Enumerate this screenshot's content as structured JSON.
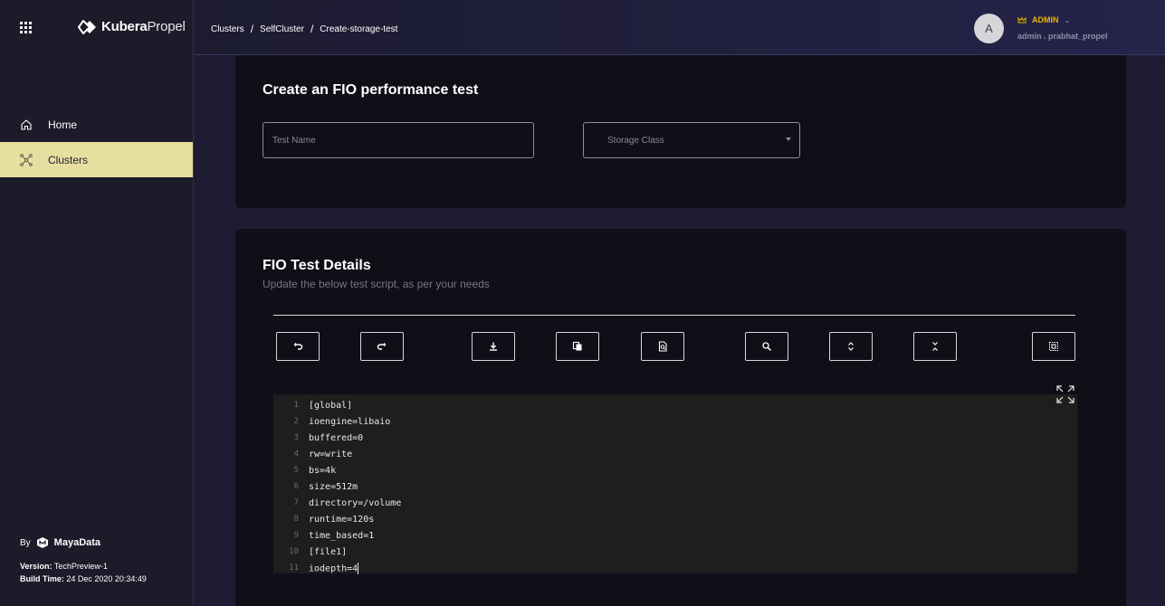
{
  "sidebar": {
    "logo": {
      "bold": "Kubera",
      "light": "Propel"
    },
    "nav": [
      {
        "label": "Home",
        "icon": "home-icon",
        "active": false
      },
      {
        "label": "Clusters",
        "icon": "clusters-icon",
        "active": true
      }
    ],
    "footer": {
      "by": "By",
      "brand": "MayaData",
      "version_label": "Version:",
      "version_value": "TechPreview-1",
      "build_label": "Build Time:",
      "build_value": "24 Dec 2020 20:34:49"
    }
  },
  "header": {
    "breadcrumb": [
      "Clusters",
      "SelfCluster",
      "Create-storage-test"
    ],
    "avatar_initial": "A",
    "role": "ADMIN",
    "username": "admin . prabhat_propel"
  },
  "create_card": {
    "title": "Create an FIO performance test",
    "test_name_placeholder": "Test Name",
    "storage_class_placeholder": "Storage Class"
  },
  "details_card": {
    "title": "FIO Test Details",
    "subtitle": "Update the below test script, as per your needs",
    "toolbar": [
      "undo-icon",
      "redo-icon",
      "download-icon",
      "copy-icon",
      "preview-icon",
      "search-icon",
      "expand-all-icon",
      "collapse-all-icon",
      "select-all-icon"
    ],
    "code_lines": [
      "[global]",
      "ioengine=libaio",
      "buffered=0",
      "rw=write",
      "bs=4k",
      "size=512m",
      "directory=/volume",
      "runtime=120s",
      "time_based=1",
      "[file1]",
      "iodepth=4"
    ]
  },
  "colors": {
    "active_nav": "#e6dfa0",
    "role_accent": "#e8b400",
    "card_bg": "#0f0f18",
    "editor_bg": "#1e1e1e"
  }
}
